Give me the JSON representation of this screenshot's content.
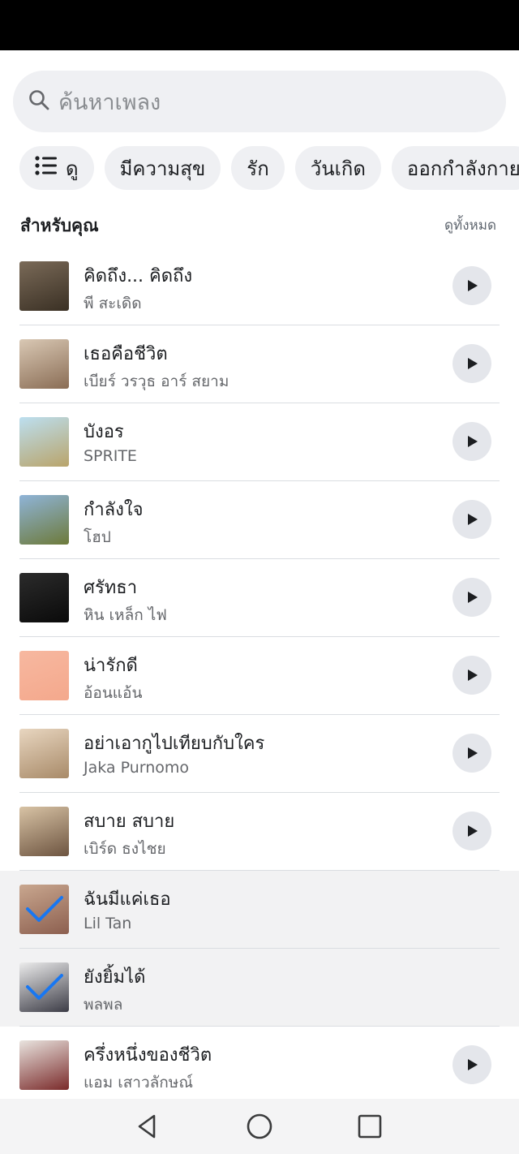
{
  "search": {
    "placeholder": "ค้นหาเพลง",
    "icon": "search-icon"
  },
  "filters": [
    {
      "label": "ดู",
      "icon": "list-icon"
    },
    {
      "label": "มีความสุข"
    },
    {
      "label": "รัก"
    },
    {
      "label": "วันเกิด"
    },
    {
      "label": "ออกกำลังกาย"
    }
  ],
  "section": {
    "title": "สำหรับคุณ",
    "see_all": "ดูทั้งหมด"
  },
  "songs": [
    {
      "title": "คิดถึง... คิดถึง",
      "artist": "พี สะเดิด",
      "selected": false,
      "cover": [
        "#7a6a58",
        "#3a3024"
      ]
    },
    {
      "title": "เธอคือชีวิต",
      "artist": "เบียร์ วรวุธ อาร์ สยาม",
      "selected": false,
      "cover": [
        "#d9c8b4",
        "#8a6d55"
      ]
    },
    {
      "title": "บังอร",
      "artist": "SPRITE",
      "selected": false,
      "cover": [
        "#bcdff0",
        "#b9a46a"
      ]
    },
    {
      "title": "กำลังใจ",
      "artist": "โฮป",
      "selected": false,
      "cover": [
        "#8fb4d8",
        "#6d7a3a"
      ]
    },
    {
      "title": "ศรัทธา",
      "artist": "หิน เหล็ก ไฟ",
      "selected": false,
      "cover": [
        "#2b2b2b",
        "#0a0a0a"
      ]
    },
    {
      "title": "น่ารักดี",
      "artist": "อ้อนแอ้น",
      "selected": false,
      "cover": [
        "#f7b8a0",
        "#f4a88c"
      ]
    },
    {
      "title": "อย่าเอากูไปเทียบกับใคร",
      "artist": "Jaka Purnomo",
      "selected": false,
      "cover": [
        "#e8d6c0",
        "#a88a68"
      ]
    },
    {
      "title": "สบาย สบาย",
      "artist": "เบิร์ด ธงไชย",
      "selected": false,
      "cover": [
        "#d8c3a5",
        "#6d5440"
      ]
    },
    {
      "title": "ฉันมีแค่เธอ",
      "artist": "Lil Tan",
      "selected": true,
      "cover": [
        "#c9a78f",
        "#8c5f4f"
      ]
    },
    {
      "title": "ยังยิ้มได้",
      "artist": "พลพล",
      "selected": true,
      "cover": [
        "#ececec",
        "#3c3c46"
      ]
    },
    {
      "title": "ครึ่งหนึ่งของชีวิต",
      "artist": "แอม เสาวลักษณ์",
      "selected": false,
      "cover": [
        "#e9e4df",
        "#7a2a2a"
      ]
    }
  ],
  "navigation": {
    "back": "back-icon",
    "home": "home-icon",
    "recents": "recents-icon"
  },
  "colors": {
    "accent": "#1877f2",
    "chip_bg": "#eff0f3",
    "play_bg": "#e4e6eb"
  }
}
